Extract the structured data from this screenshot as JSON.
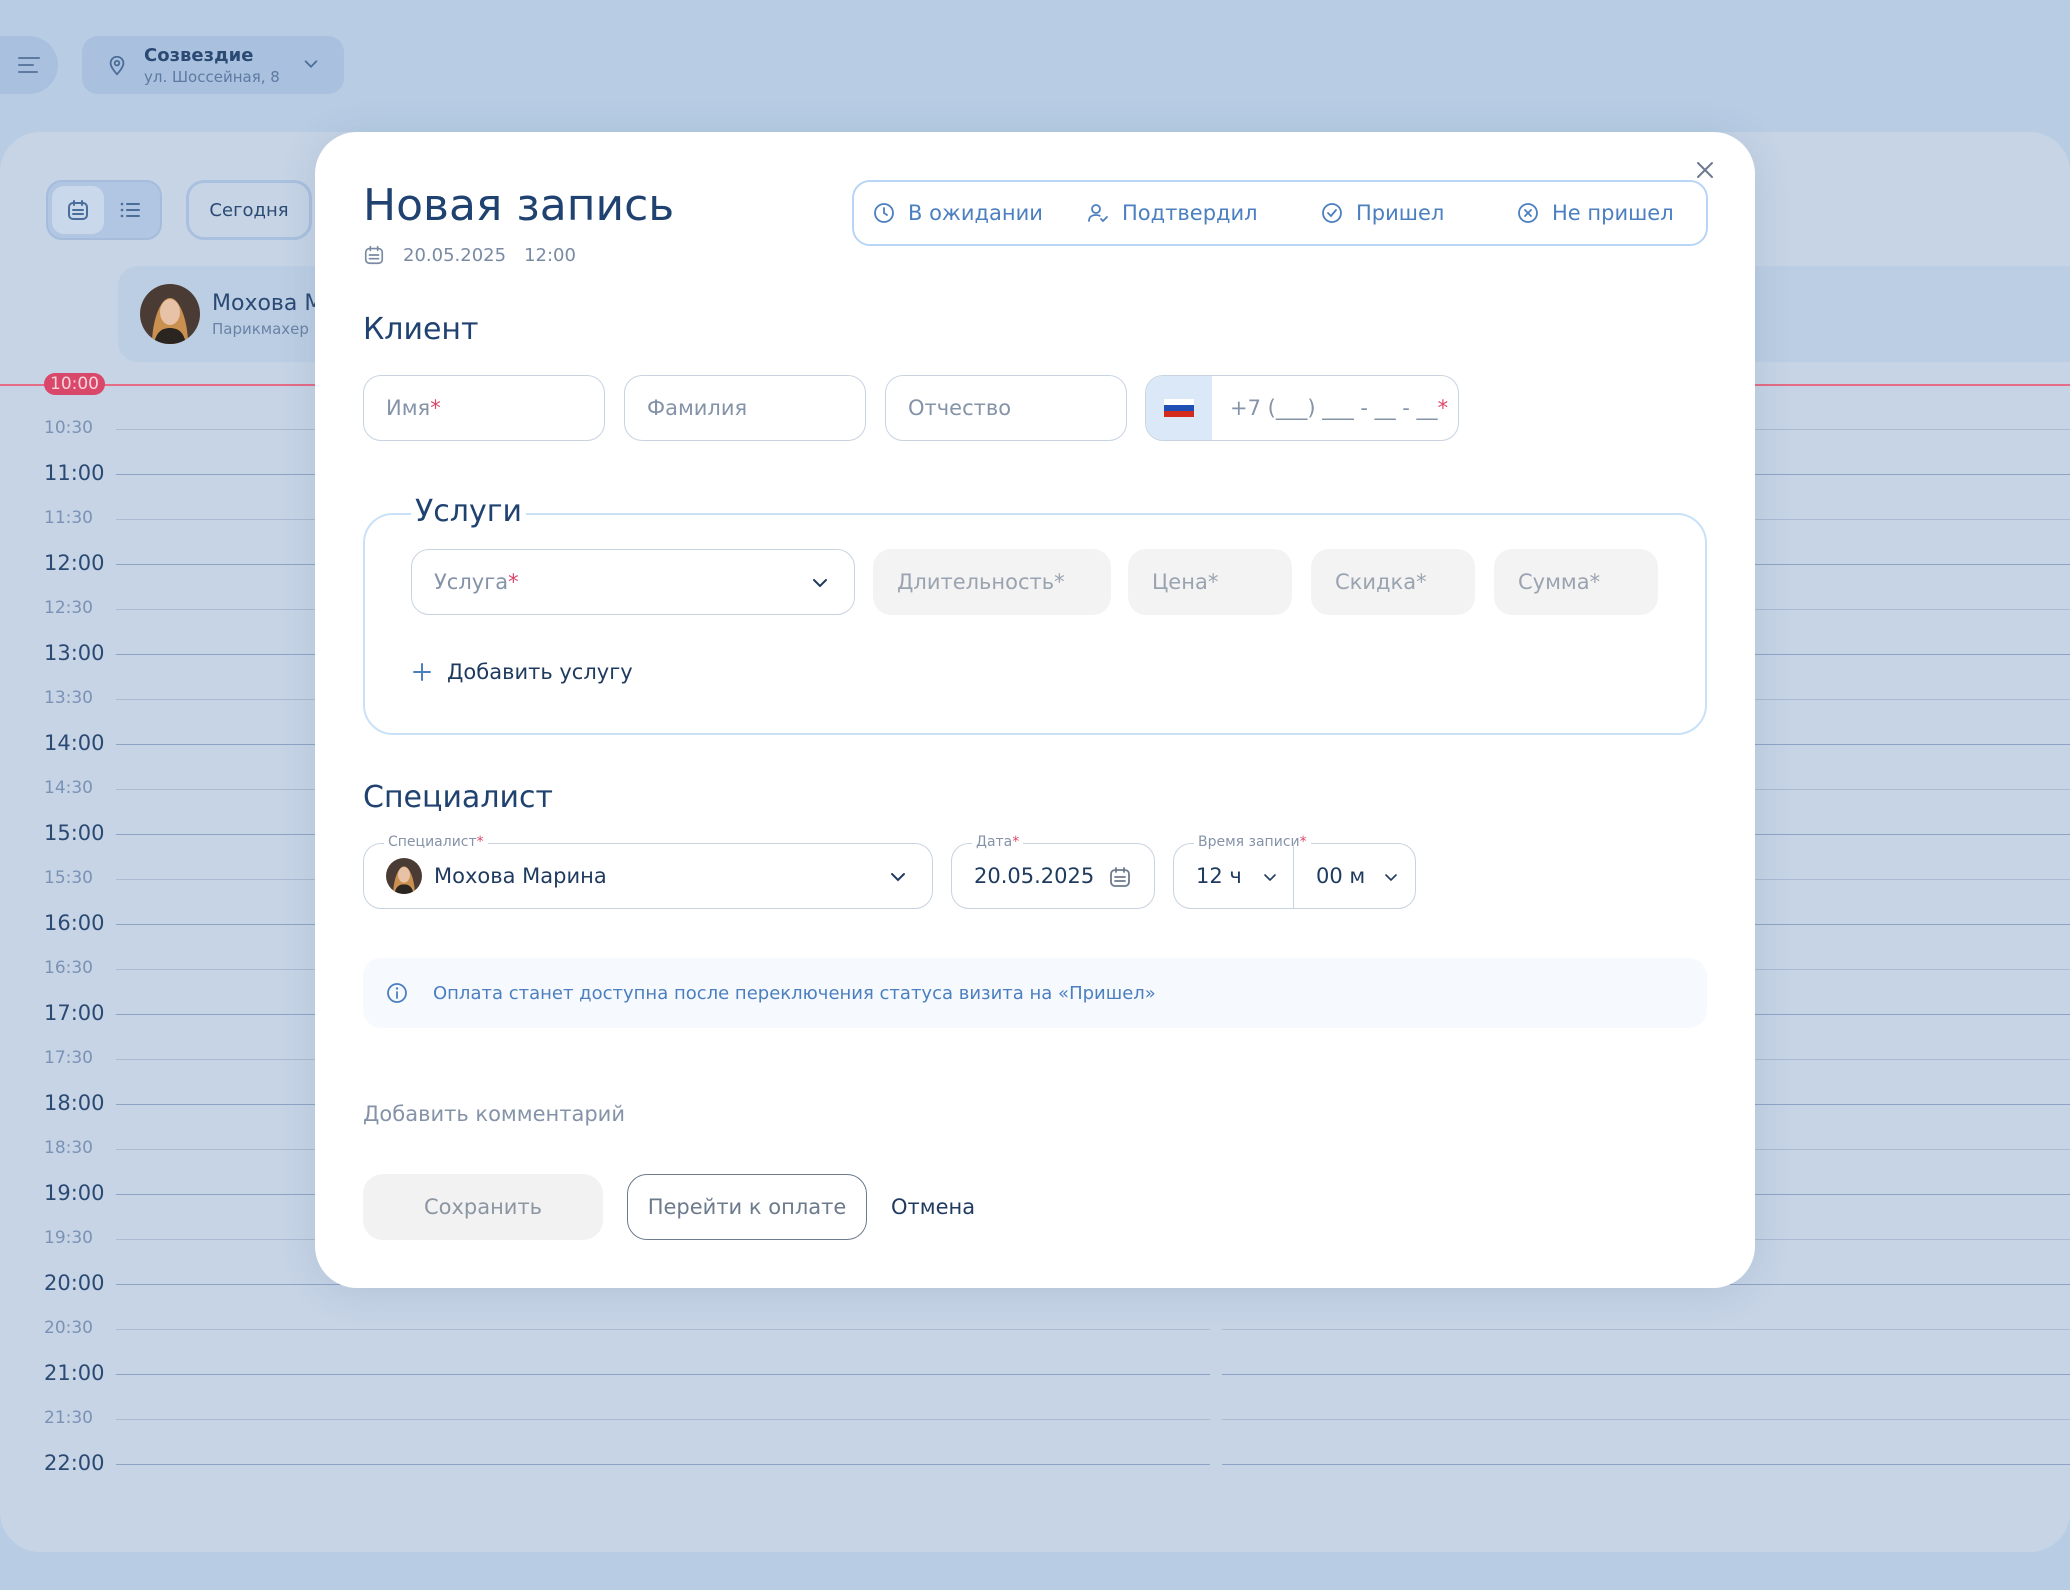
{
  "location": {
    "name": "Созвездие",
    "address": "ул. Шоссейная, 8"
  },
  "toolbar": {
    "today_label": "Сегодня"
  },
  "specialist_header": {
    "name": "Мохова М",
    "role": "Парикмахер"
  },
  "timeline": {
    "now": "10:00",
    "slots": [
      "10:30",
      "11:00",
      "11:30",
      "12:00",
      "12:30",
      "13:00",
      "13:30",
      "14:00",
      "14:30",
      "15:00",
      "15:30",
      "16:00",
      "16:30",
      "17:00",
      "17:30",
      "18:00",
      "18:30",
      "19:00",
      "19:30",
      "20:00",
      "20:30",
      "21:00",
      "21:30",
      "22:00"
    ]
  },
  "modal": {
    "title": "Новая запись",
    "date": "20.05.2025",
    "time": "12:00",
    "statuses": [
      {
        "label": "В ожидании",
        "icon": "clock-icon"
      },
      {
        "label": "Подтвердил",
        "icon": "user-check-icon"
      },
      {
        "label": "Пришел",
        "icon": "check-circle-icon"
      },
      {
        "label": "Не пришел",
        "icon": "x-circle-icon"
      }
    ],
    "client": {
      "title": "Клиент",
      "first_name_placeholder": "Имя",
      "last_name_placeholder": "Фамилия",
      "patronymic_placeholder": "Отчество",
      "phone_placeholder": "+7 (___) ___ - __ - __",
      "required_mark": "*"
    },
    "services": {
      "title": "Услуги",
      "service_placeholder": "Услуга",
      "duration_placeholder": "Длительность*",
      "price_placeholder": "Цена*",
      "discount_placeholder": "Скидка*",
      "sum_placeholder": "Сумма*",
      "add_label": "Добавить услугу"
    },
    "specialist": {
      "title": "Специалист",
      "specialist_label": "Специалист",
      "specialist_value": "Мохова Марина",
      "date_label": "Дата",
      "date_value": "20.05.2025",
      "time_label": "Время записи",
      "hour_value": "12 ч",
      "minute_value": "00 м"
    },
    "info_text": "Оплата станет доступна после переключения статуса визита на «Пришел»",
    "add_comment_label": "Добавить комментарий",
    "buttons": {
      "save": "Сохранить",
      "pay": "Перейти к оплате",
      "cancel": "Отмена"
    }
  }
}
